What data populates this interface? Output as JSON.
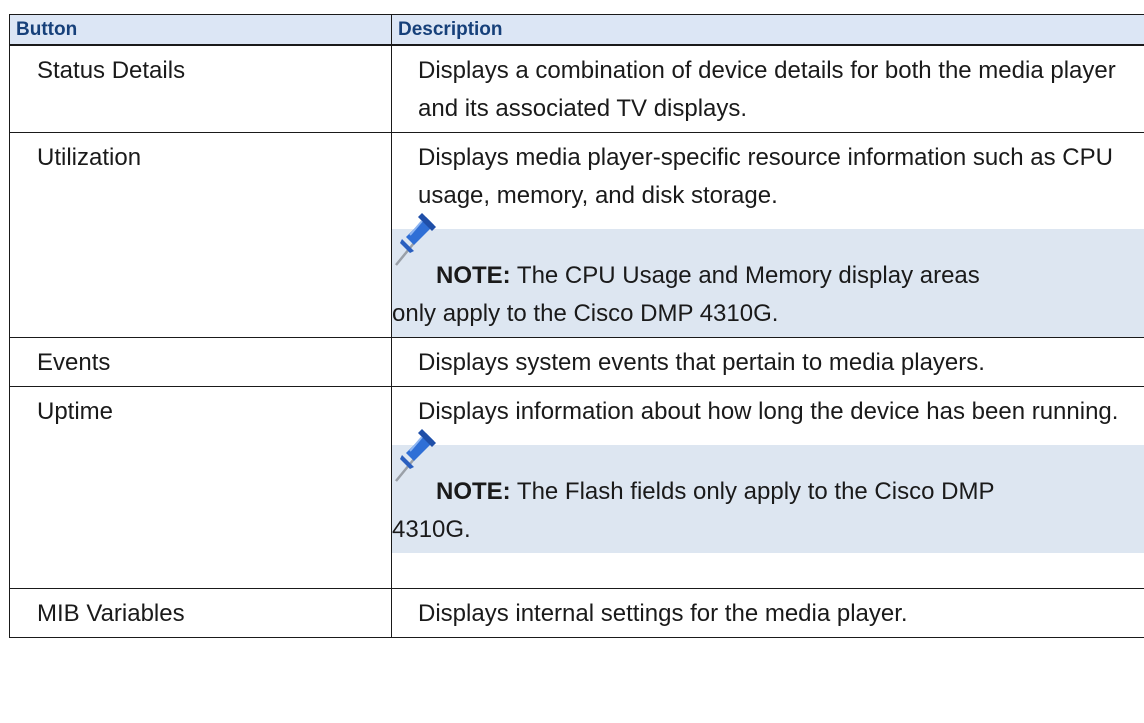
{
  "table": {
    "headers": {
      "button": "Button",
      "description": "Description"
    },
    "rows": [
      {
        "button": "Status Details",
        "description": "Displays a combination of device details for both the media player and its associated TV displays."
      },
      {
        "button": "Utilization",
        "description": "Displays media player-specific resource information such as CPU usage, memory, and disk storage.",
        "note": {
          "label": "NOTE:",
          "line1": "The CPU Usage and Memory display areas",
          "line2": "only apply to the Cisco DMP 4310G."
        }
      },
      {
        "button": "Events",
        "description": "Displays system events that pertain to media players."
      },
      {
        "button": "Uptime",
        "description": "Displays information about how long the device has been running.",
        "note": {
          "label": "NOTE:",
          "line1": "The Flash fields only apply to the Cisco DMP",
          "line2": "4310G."
        }
      },
      {
        "button": "MIB Variables",
        "description": "Displays internal settings for the media player."
      }
    ]
  },
  "icons": {
    "note": "pushpin-icon"
  },
  "colors": {
    "header_bg": "#dce6f5",
    "header_text": "#16407a",
    "note_bg": "#dde6f1",
    "pin_blue": "#2f6fd6"
  }
}
